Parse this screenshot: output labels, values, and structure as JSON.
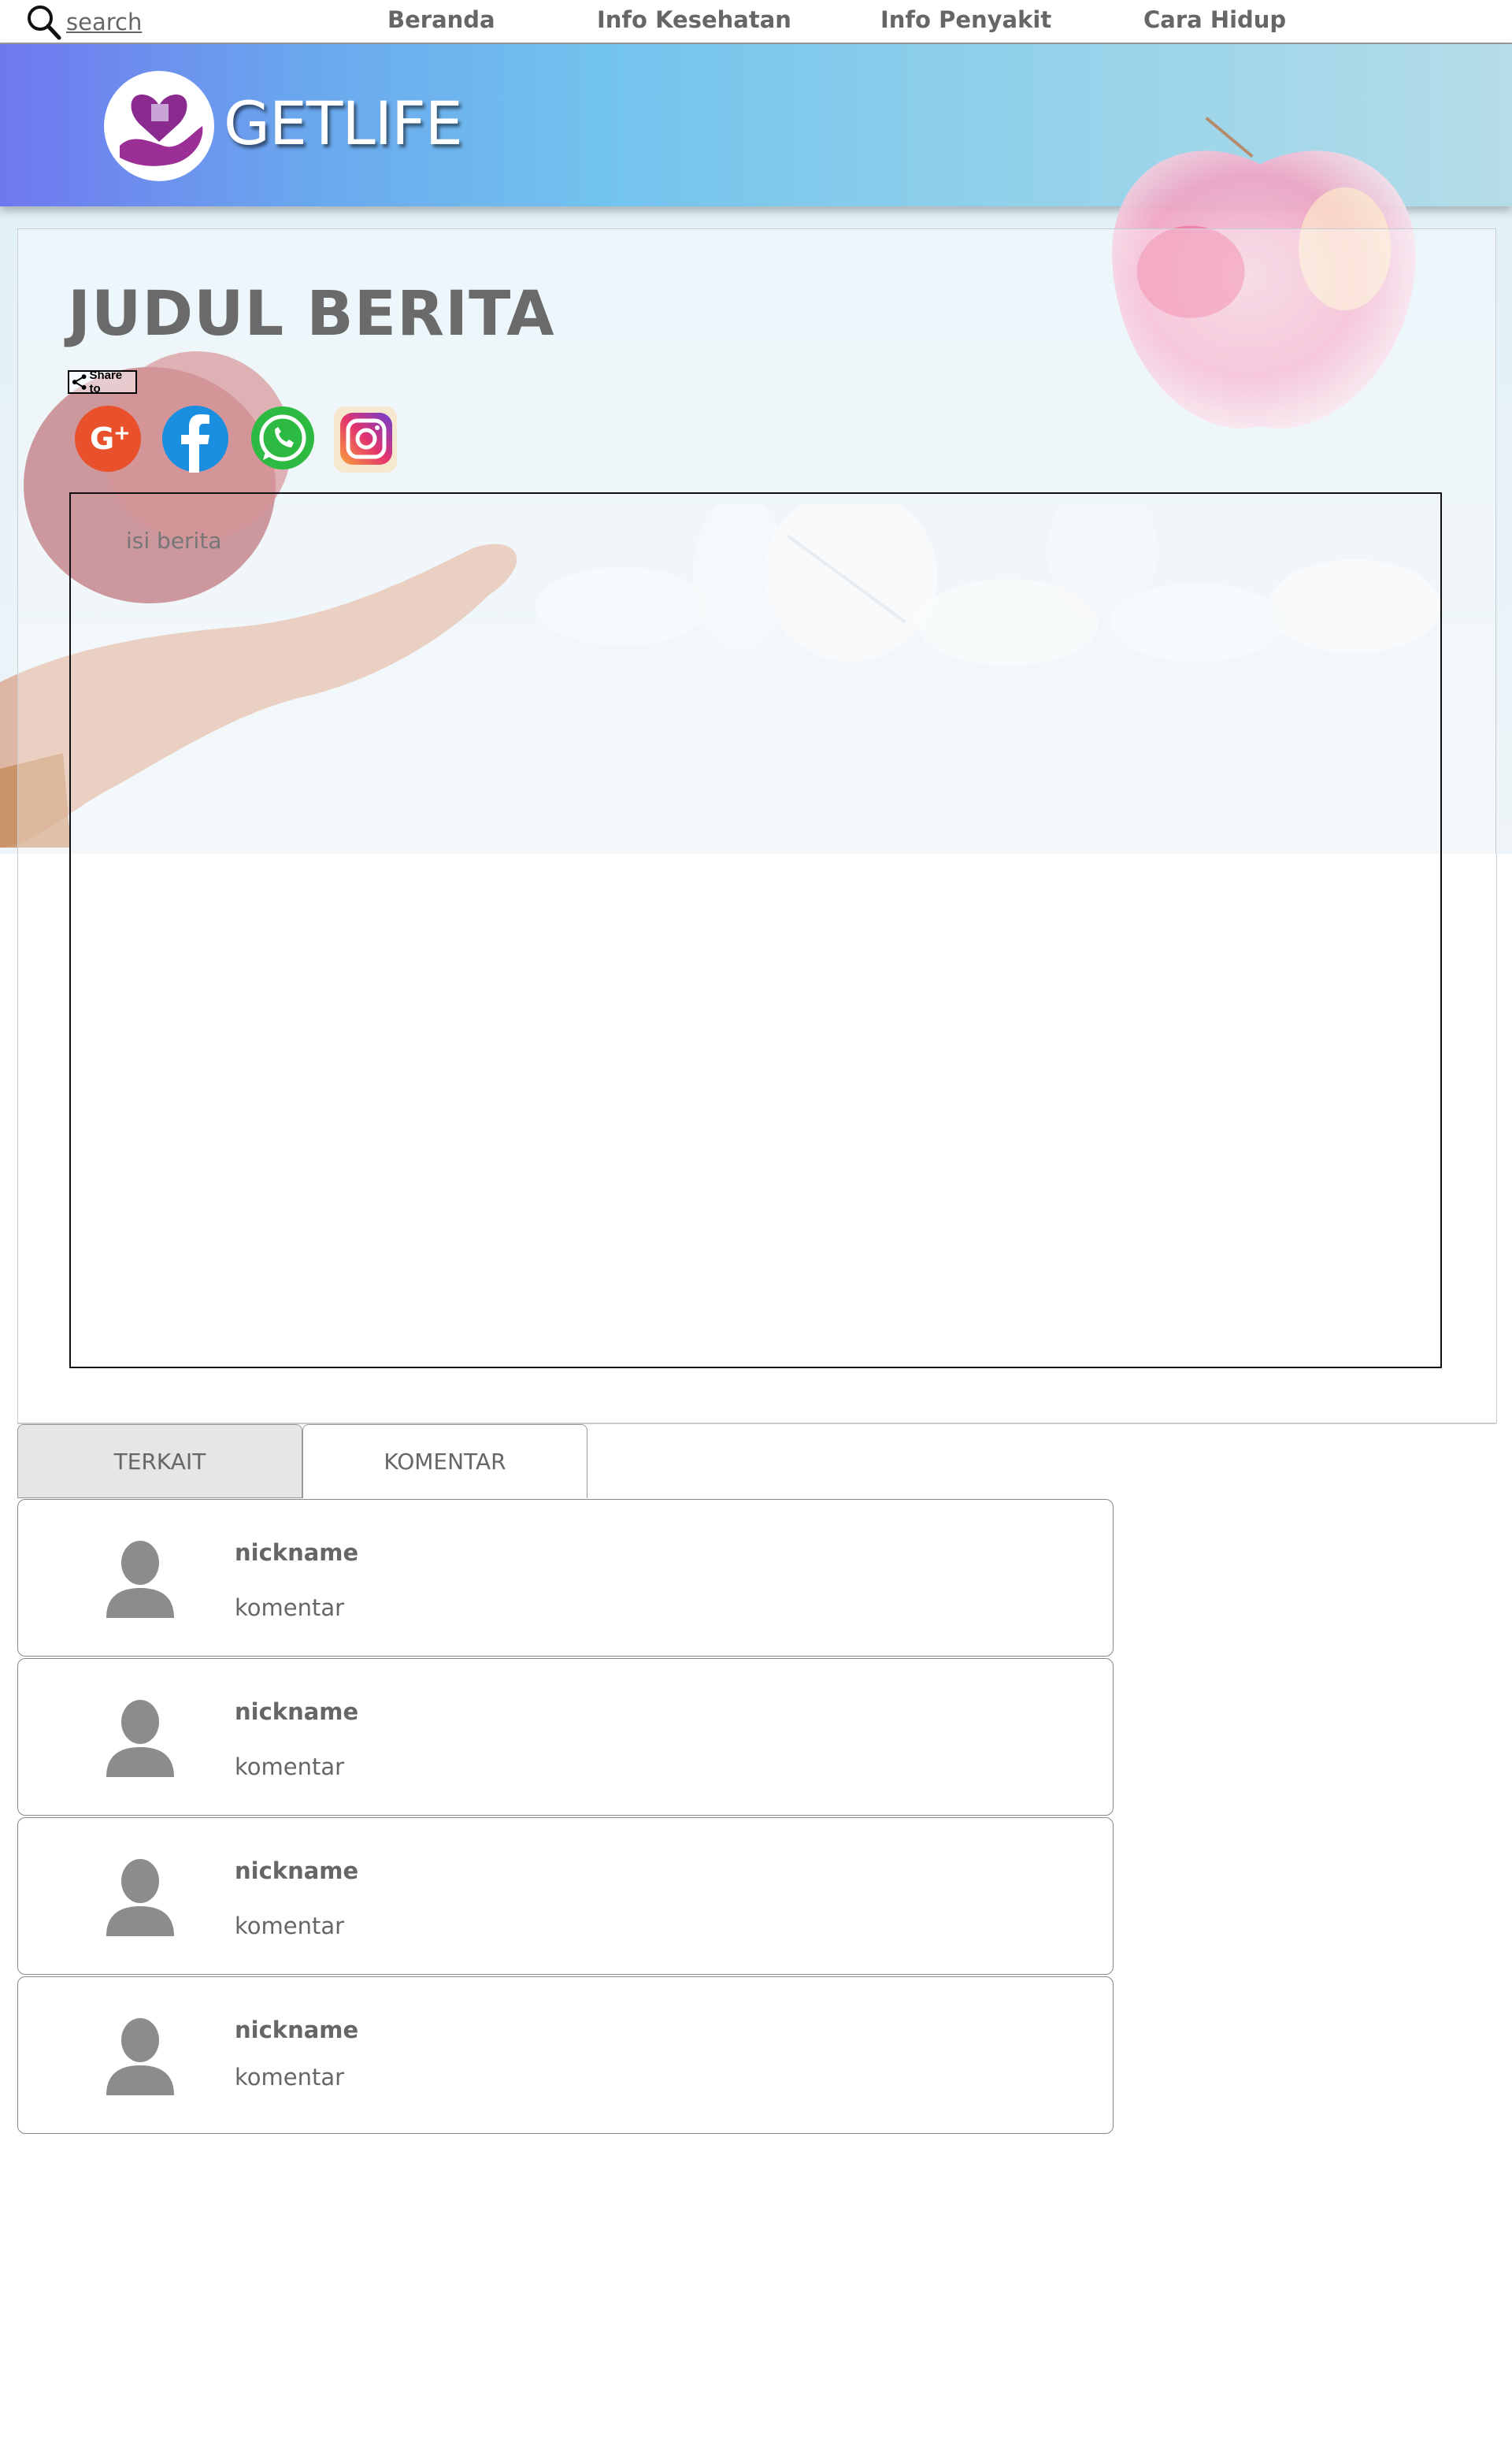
{
  "nav": {
    "search_label": "search",
    "items": [
      "Beranda",
      "Info Kesehatan",
      "Info Penyakit",
      "Cara Hidup"
    ]
  },
  "brand": {
    "name": "GETLIFE"
  },
  "article": {
    "title": "JUDUL BERITA",
    "share_label": "Share to",
    "content": "isi berita",
    "social": [
      "google-plus-icon",
      "facebook-icon",
      "whatsapp-icon",
      "instagram-icon"
    ]
  },
  "tabs": {
    "related": "TERKAIT",
    "comments": "KOMENTAR"
  },
  "comments": [
    {
      "nickname": "nickname",
      "text": "komentar"
    },
    {
      "nickname": "nickname",
      "text": "komentar"
    },
    {
      "nickname": "nickname",
      "text": "komentar"
    },
    {
      "nickname": "nickname",
      "text": "komentar"
    }
  ],
  "colors": {
    "banner_start": "#6f78ef",
    "banner_end": "#b5dde8",
    "google_plus": "#e8512c",
    "facebook": "#1a8fe0",
    "whatsapp": "#2dba43",
    "instagram": "#d9336f"
  }
}
